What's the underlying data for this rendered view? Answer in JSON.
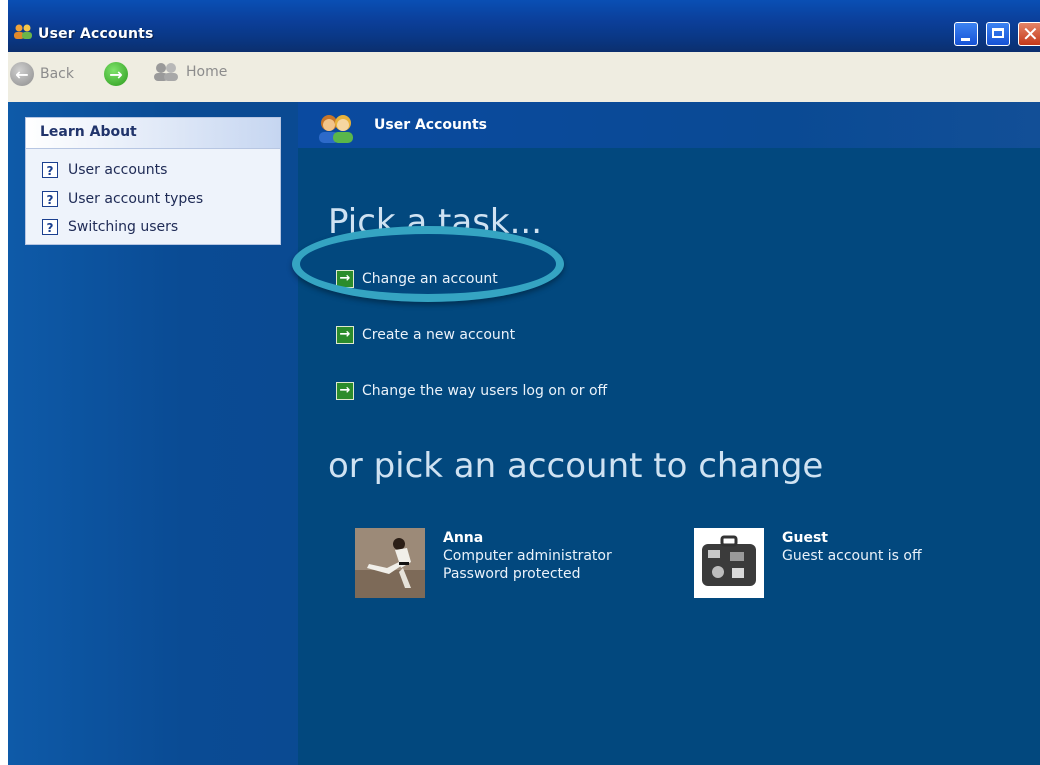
{
  "window": {
    "title": "User Accounts",
    "controls": [
      "minimize",
      "maximize",
      "close"
    ]
  },
  "toolbar": {
    "back_label": "Back",
    "forward_icon": "forward-arrow",
    "home_label": "Home"
  },
  "learn_about": {
    "title": "Learn About",
    "items": [
      {
        "label": "User accounts",
        "icon": "help-icon"
      },
      {
        "label": "User account types",
        "icon": "help-icon"
      },
      {
        "label": "Switching users",
        "icon": "help-icon"
      }
    ]
  },
  "main": {
    "header_title": "User Accounts",
    "pick_task": "Pick a task...",
    "tasks": [
      {
        "label": "Change an account",
        "highlighted": true
      },
      {
        "label": "Create a new account",
        "highlighted": false
      },
      {
        "label": "Change the way users log on or off",
        "highlighted": false
      }
    ],
    "pick_account": "or pick an account to change",
    "accounts": [
      {
        "name": "Anna",
        "line1": "Computer administrator",
        "line2": "Password protected",
        "picture": "karate-photo"
      },
      {
        "name": "Guest",
        "line1": "Guest account is off",
        "line2": "",
        "picture": "suitcase-photo"
      }
    ]
  },
  "colors": {
    "titlebar": "#0a3f9a",
    "content_bg": "#02487e",
    "sidebar_bg": "#0a4b94",
    "highlight_ring": "#35a4c2",
    "task_arrow": "#2b8c2b"
  }
}
